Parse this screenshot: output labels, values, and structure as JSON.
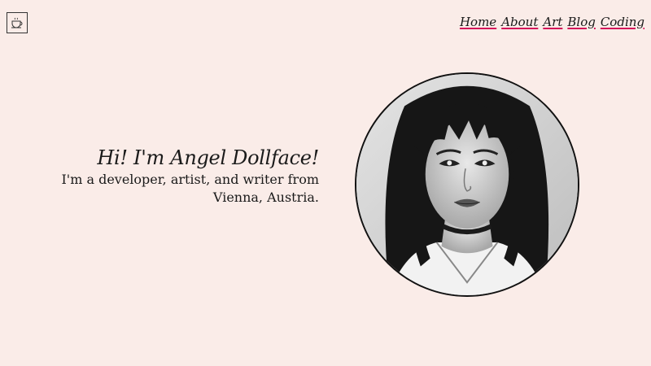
{
  "header": {
    "logo_icon": "cup-icon",
    "nav": [
      {
        "label": "Home"
      },
      {
        "label": "About"
      },
      {
        "label": "Art"
      },
      {
        "label": "Blog"
      },
      {
        "label": "Coding"
      }
    ]
  },
  "intro": {
    "title": "Hi! I'm Angel Dollface!",
    "description": "I'm a developer, artist, and writer from Vienna, Austria."
  },
  "colors": {
    "background": "#faece8",
    "link_underline": "#d4145a",
    "text": "#1a1a1a"
  }
}
